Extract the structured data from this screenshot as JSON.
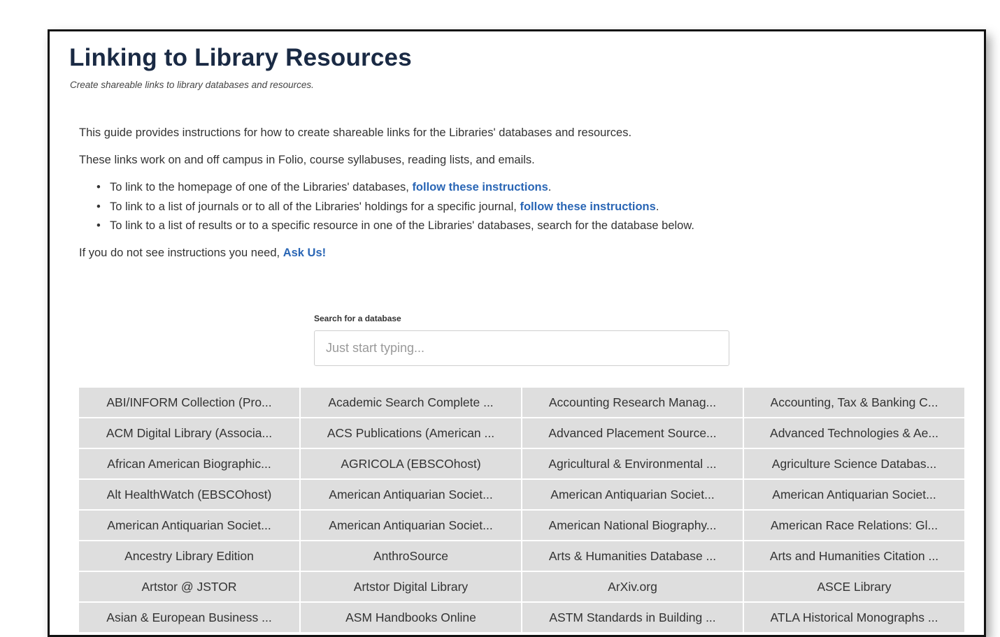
{
  "header": {
    "title": "Linking to Library Resources",
    "subtitle": "Create shareable links to library databases and resources."
  },
  "intro": {
    "p1": "This guide provides instructions for how to create shareable links for the Libraries' databases and resources.",
    "p2": "These links work on and off campus in Folio, course syllabuses, reading lists, and emails.",
    "bullets": [
      {
        "text": "To link to the homepage of one of the Libraries' databases, ",
        "link": "follow these instructions",
        "after": "."
      },
      {
        "text": "To link to a list of journals or to all of the Libraries' holdings for a specific journal, ",
        "link": "follow these instructions",
        "after": "."
      },
      {
        "text": "To link to a list of results or to a specific resource in one of the Libraries' databases, search for the database below.",
        "link": "",
        "after": ""
      }
    ],
    "ask_prefix": "If you do not see instructions you need, ",
    "ask_link": "Ask Us!"
  },
  "search": {
    "label": "Search for a database",
    "placeholder": "Just start typing...",
    "value": ""
  },
  "databases": [
    "ABI/INFORM Collection (Pro...",
    "Academic Search Complete ...",
    "Accounting Research Manag...",
    "Accounting, Tax & Banking C...",
    "ACM Digital Library (Associa...",
    "ACS Publications (American ...",
    "Advanced Placement Source...",
    "Advanced Technologies & Ae...",
    "African American Biographic...",
    "AGRICOLA (EBSCOhost)",
    "Agricultural & Environmental ...",
    "Agriculture Science Databas...",
    "Alt HealthWatch (EBSCOhost)",
    "American Antiquarian Societ...",
    "American Antiquarian Societ...",
    "American Antiquarian Societ...",
    "American Antiquarian Societ...",
    "American Antiquarian Societ...",
    "American National Biography...",
    "American Race Relations: Gl...",
    "Ancestry Library Edition",
    "AnthroSource",
    "Arts & Humanities Database ...",
    "Arts and Humanities Citation ...",
    "Artstor @ JSTOR",
    "Artstor Digital Library",
    "ArXiv.org",
    "ASCE Library",
    "Asian & European Business ...",
    "ASM Handbooks Online",
    "ASTM Standards in Building ...",
    "ATLA Historical Monographs ..."
  ]
}
